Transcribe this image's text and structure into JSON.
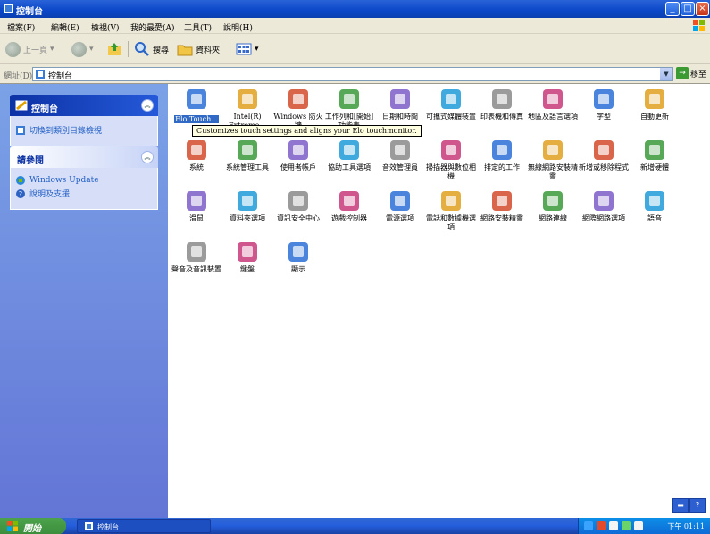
{
  "window": {
    "title": "控制台"
  },
  "menu": [
    "檔案(F)",
    "編輯(E)",
    "檢視(V)",
    "我的最愛(A)",
    "工具(T)",
    "說明(H)"
  ],
  "toolbar": {
    "back": "上一頁",
    "search": "搜尋",
    "folders": "資料夾"
  },
  "address": {
    "label": "網址(D)",
    "value": "控制台",
    "go": "移至"
  },
  "taskpane": {
    "control_panel": {
      "title": "控制台",
      "link": "切換到類別目錄檢視"
    },
    "see_also": {
      "title": "請參閱",
      "links": [
        "Windows Update",
        "說明及支援"
      ]
    }
  },
  "items": [
    {
      "label": "Elo Touch...",
      "icon": "elo-touchmonitor-icon",
      "selected": true
    },
    {
      "label": "Intel(R) Extreme...",
      "icon": "intel-graphics-icon"
    },
    {
      "label": "Windows 防火牆",
      "icon": "firewall-icon"
    },
    {
      "label": "工作列和[開始]功能表",
      "icon": "taskbar-icon"
    },
    {
      "label": "日期和時間",
      "icon": "clock-icon"
    },
    {
      "label": "可攜式媒體裝置",
      "icon": "portable-device-icon"
    },
    {
      "label": "印表機和傳真",
      "icon": "printer-icon"
    },
    {
      "label": "地區及語言選項",
      "icon": "globe-icon"
    },
    {
      "label": "字型",
      "icon": "fonts-folder-icon"
    },
    {
      "label": "自動更新",
      "icon": "windows-update-icon"
    },
    {
      "label": "系統",
      "icon": "system-icon"
    },
    {
      "label": "系統管理工具",
      "icon": "admin-tools-icon"
    },
    {
      "label": "使用者帳戶",
      "icon": "users-icon"
    },
    {
      "label": "協助工具選項",
      "icon": "accessibility-icon"
    },
    {
      "label": "音效管理員",
      "icon": "sound-manager-icon"
    },
    {
      "label": "掃描器與數位相機",
      "icon": "scanner-icon"
    },
    {
      "label": "排定的工作",
      "icon": "scheduled-tasks-icon"
    },
    {
      "label": "無線網路安裝精靈",
      "icon": "wireless-icon"
    },
    {
      "label": "新增或移除程式",
      "icon": "add-remove-icon"
    },
    {
      "label": "新增硬體",
      "icon": "add-hardware-icon"
    },
    {
      "label": "滑鼠",
      "icon": "mouse-icon"
    },
    {
      "label": "資料夾選項",
      "icon": "folder-options-icon"
    },
    {
      "label": "資訊安全中心",
      "icon": "security-center-icon"
    },
    {
      "label": "遊戲控制器",
      "icon": "game-controller-icon"
    },
    {
      "label": "電源選項",
      "icon": "power-icon"
    },
    {
      "label": "電話和數據機選項",
      "icon": "phone-modem-icon"
    },
    {
      "label": "網路安裝精靈",
      "icon": "network-setup-icon"
    },
    {
      "label": "網路連線",
      "icon": "network-connections-icon"
    },
    {
      "label": "網際網路選項",
      "icon": "internet-options-icon"
    },
    {
      "label": "語音",
      "icon": "speech-icon"
    },
    {
      "label": "聲音及音訊裝置",
      "icon": "speaker-icon"
    },
    {
      "label": "鍵盤",
      "icon": "keyboard-icon"
    },
    {
      "label": "顯示",
      "icon": "display-icon"
    }
  ],
  "tooltip": "Customizes touch settings and aligns your Elo touchmonitor.",
  "taskbar": {
    "start": "開始",
    "task": "控制台",
    "clock": "下午 01:11"
  }
}
